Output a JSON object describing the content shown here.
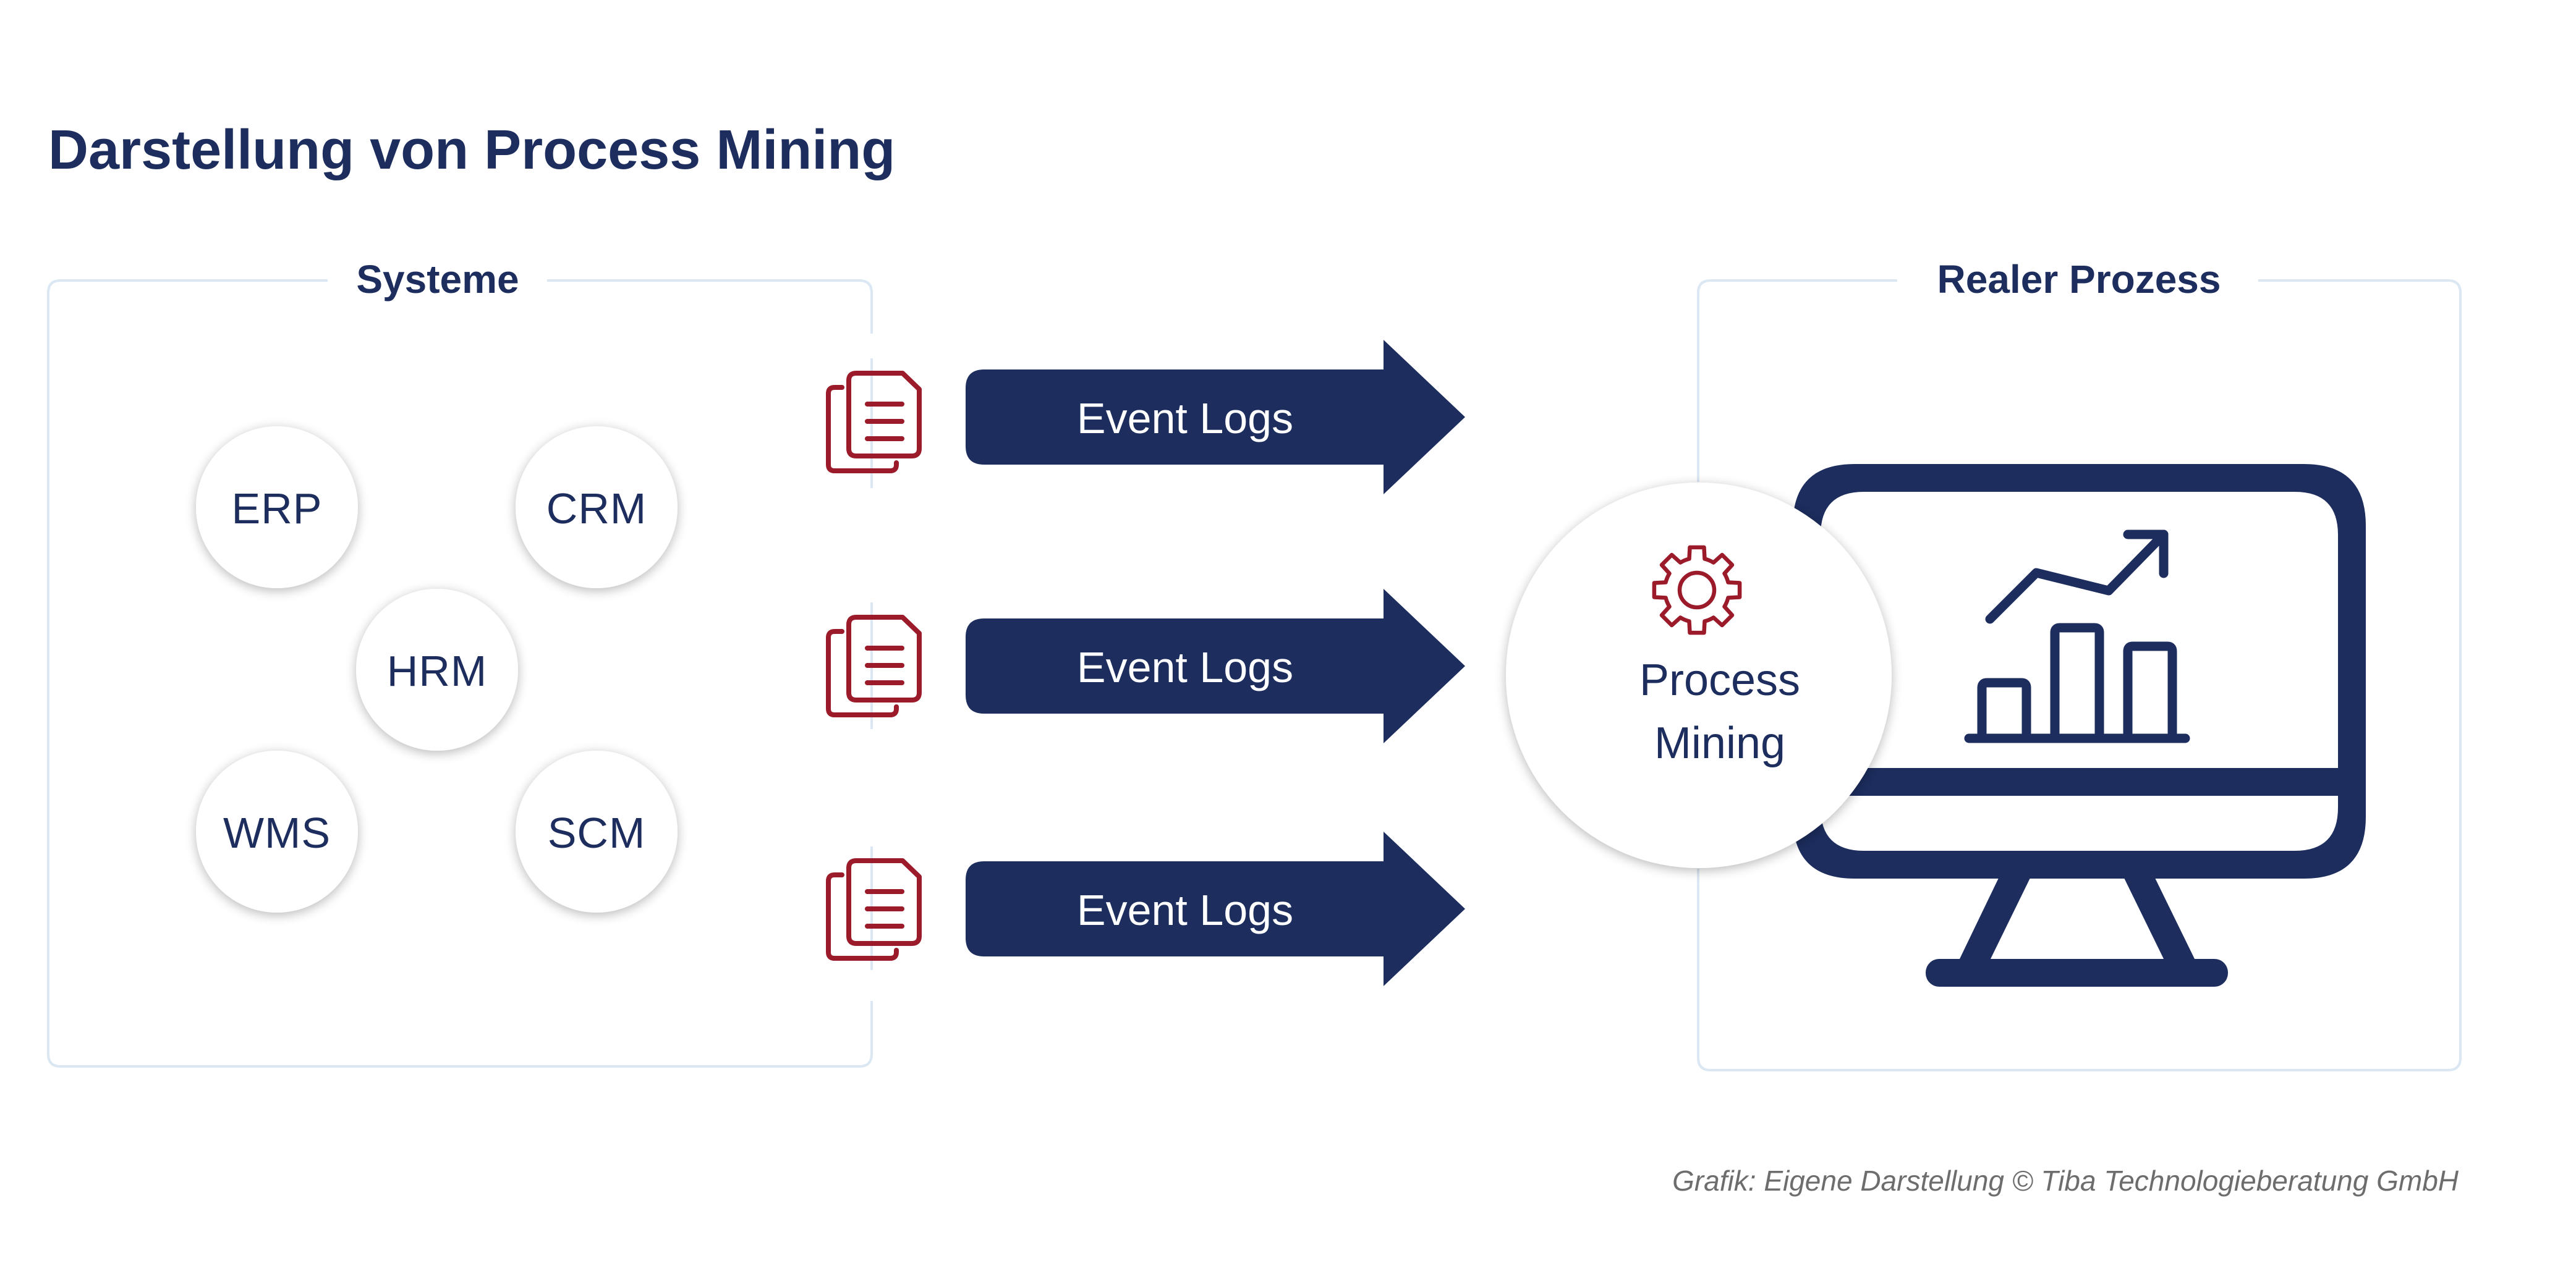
{
  "title": "Darstellung von Process Mining",
  "colors": {
    "navy": "#1c2d5e",
    "accent_red": "#9b1b2a",
    "box_border": "#dbe7f2",
    "footer_gray": "#6d6d6d",
    "background": "#ffffff"
  },
  "systems_panel": {
    "label": "Systeme",
    "systems": [
      {
        "id": "erp",
        "label": "ERP"
      },
      {
        "id": "crm",
        "label": "CRM"
      },
      {
        "id": "hrm",
        "label": "HRM"
      },
      {
        "id": "wms",
        "label": "WMS"
      },
      {
        "id": "scm",
        "label": "SCM"
      }
    ]
  },
  "flows": [
    {
      "icon": "documents-icon",
      "label": "Event Logs"
    },
    {
      "icon": "documents-icon",
      "label": "Event Logs"
    },
    {
      "icon": "documents-icon",
      "label": "Event Logs"
    }
  ],
  "process_panel": {
    "label": "Realer Prozess",
    "process_mining": {
      "icon": "gear-icon",
      "line1": "Process",
      "line2": "Mining"
    },
    "monitor": {
      "icon": "monitor-icon",
      "chart_icon": "bar-chart-trend-up-icon"
    }
  },
  "footer": {
    "credit": "Grafik: Eigene Darstellung © Tiba Technologieberatung GmbH"
  }
}
